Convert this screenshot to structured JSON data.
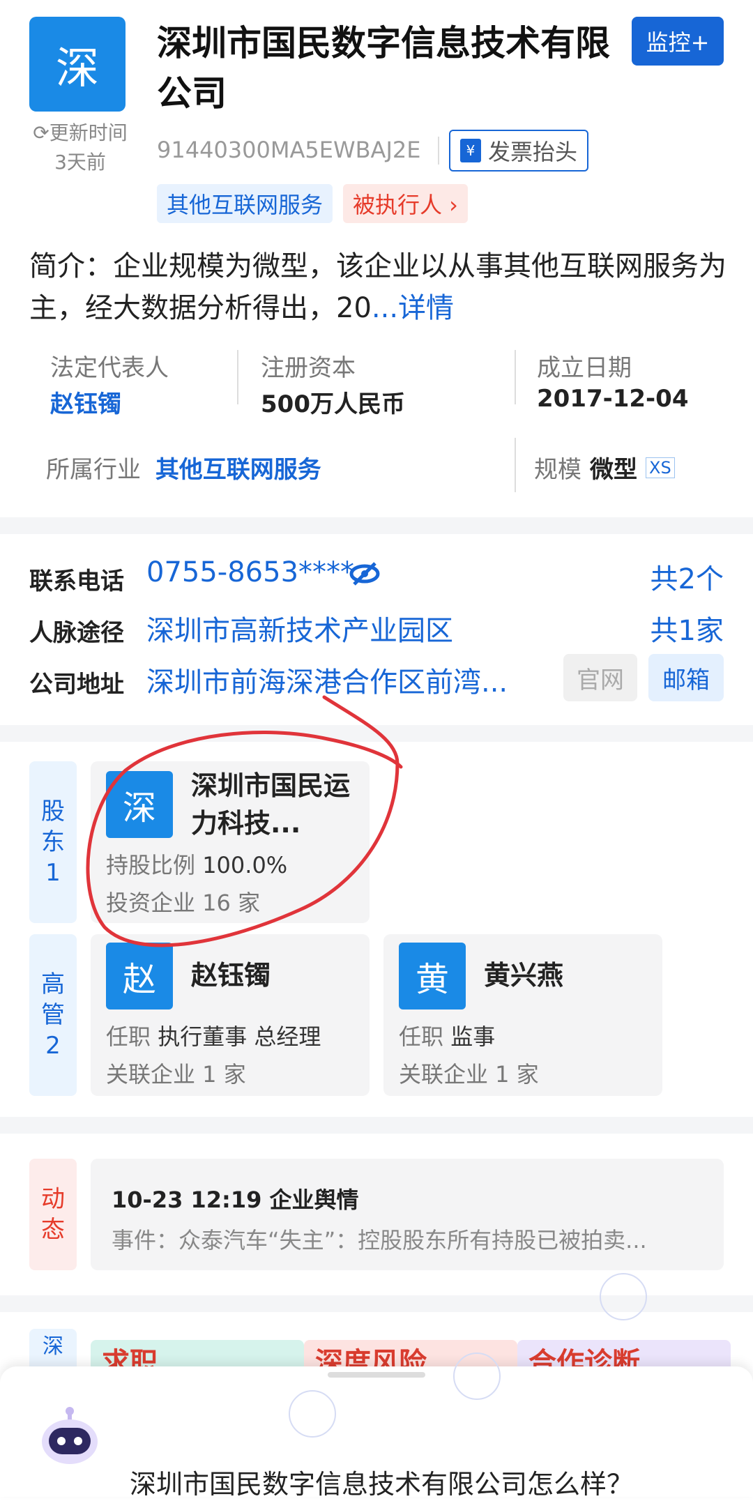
{
  "company": {
    "logo_char": "深",
    "name": "深圳市国民数字信息技术有限公司",
    "monitor_button": "监控+",
    "update_label": "更新时间",
    "update_time": "3天前",
    "credit_code": "91440300MA5EWBAJ2E",
    "invoice_label": "发票抬头",
    "invoice_icon": "¥",
    "tags": [
      "其他互联网服务",
      "被执行人 ›"
    ],
    "intro_text": "简介：企业规模为微型，该企业以从事其他互联网服务为主，经大数据分析得出，20",
    "intro_more": "...详情"
  },
  "info": {
    "legal_rep_label": "法定代表人",
    "legal_rep_value": "赵钰镯",
    "capital_label": "注册资本",
    "capital_value": "500万人民币",
    "founded_label": "成立日期",
    "founded_value": "2017-12-04",
    "industry_label": "所属行业",
    "industry_value": "其他互联网服务",
    "scale_label": "规模",
    "scale_value": "微型",
    "scale_badge": "XS"
  },
  "contact": {
    "phone_label": "联系电话",
    "phone_value": "0755-8653****",
    "phone_count": "共2个",
    "network_label": "人脉途径",
    "network_value": "深圳市高新技术产业园区",
    "network_count": "共1家",
    "address_label": "公司地址",
    "address_value": "深圳市前海深港合作区前湾...",
    "website_button": "官网",
    "email_button": "邮箱"
  },
  "shareholders": {
    "tab_label": "股\n东\n1",
    "items": [
      {
        "avatar": "深",
        "name": "深圳市国民运力科技...",
        "line1_label": "持股比例",
        "line1_value": "100.0%",
        "line2": "投资企业 16 家"
      }
    ]
  },
  "executives": {
    "tab_label": "高\n管\n2",
    "items": [
      {
        "avatar": "赵",
        "name": "赵钰镯",
        "line1_label": "任职",
        "line1_value": "执行董事 总经理",
        "line2": "关联企业 1 家"
      },
      {
        "avatar": "黄",
        "name": "黄兴燕",
        "line1_label": "任职",
        "line1_value": "监事",
        "line2": "关联企业 1 家"
      }
    ]
  },
  "news": {
    "tab_label": "动\n态",
    "headline": "10-23 12:19 企业舆情",
    "event": "事件：众泰汽车“失主”：控股股东所有持股已被拍卖..."
  },
  "bottom_banner": {
    "tab_label": "深",
    "items": [
      "求职",
      "深度风险",
      "合作诊断"
    ]
  },
  "assistant": {
    "question": "深圳市国民数字信息技术有限公司怎么样？"
  },
  "annotation_color": "#e0343a"
}
